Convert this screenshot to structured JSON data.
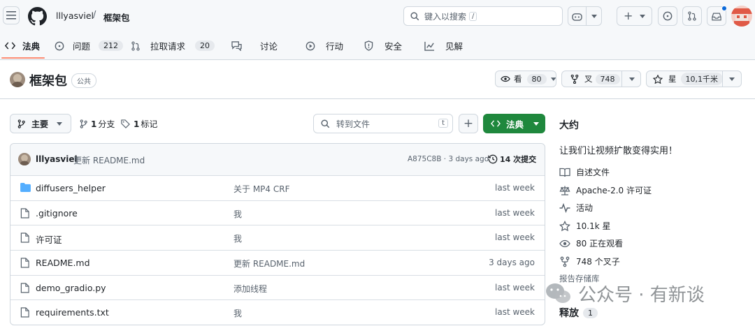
{
  "header": {
    "owner": "lllyasviel",
    "separator": "/",
    "repo": "框架包",
    "search_placeholder": "键入以搜索",
    "search_key": "/"
  },
  "tabs": [
    {
      "label": "法典",
      "icon": "code-icon"
    },
    {
      "label": "问题",
      "count": "212",
      "icon": "issue-icon"
    },
    {
      "label": "拉取请求",
      "count": "20",
      "icon": "pull-request-icon"
    },
    {
      "label": "讨论",
      "icon": "discussion-icon"
    },
    {
      "label": "行动",
      "icon": "play-icon"
    },
    {
      "label": "安全",
      "icon": "shield-icon"
    },
    {
      "label": "见解",
      "icon": "graph-icon"
    }
  ],
  "repo_header": {
    "name": "框架包",
    "visibility": "公共",
    "watch_label": "看",
    "watch_count": "80",
    "fork_label": "叉",
    "fork_count": "748",
    "star_label": "星",
    "star_count": "10,1千米"
  },
  "toolbar": {
    "branch": "主要",
    "branches_count": "1",
    "branches_label": "分支",
    "tags_count": "1",
    "tags_label": "标记",
    "goto_placeholder": "转到文件",
    "goto_key": "t",
    "add_label": "+",
    "code_label": "法典"
  },
  "commit": {
    "author": "lllyasviel",
    "message": "更新 README.md",
    "hash_time": "A875C8B · 3 days ago",
    "commits_label": "14 次提交"
  },
  "files": [
    {
      "name": "diffusers_helper",
      "type": "folder",
      "message": "关于 MP4 CRF",
      "date": "last week"
    },
    {
      "name": ".gitignore",
      "type": "file",
      "message": "我",
      "date": "last week"
    },
    {
      "name": "许可证",
      "type": "file",
      "message": "我",
      "date": "last week"
    },
    {
      "name": "README.md",
      "type": "file",
      "message": "更新 README.md",
      "date": "3 days ago"
    },
    {
      "name": "demo_gradio.py",
      "type": "file",
      "message": "添加线程",
      "date": "last week"
    },
    {
      "name": "requirements.txt",
      "type": "file",
      "message": "我",
      "date": "last week"
    }
  ],
  "about": {
    "title": "大约",
    "description": "让我们让视频扩散变得实用！",
    "readme": "自述文件",
    "license": "Apache-2.0 许可证",
    "activity": "活动",
    "stars": "10.1k 星",
    "watching": "80 正在观看",
    "forks": "748 个叉子",
    "report": "报告存储库",
    "releases_label": "释放",
    "releases_count": "1"
  },
  "watermark": "公众号 · 有新谈",
  "colors": {
    "accent_green": "#1f883d",
    "folder_blue": "#54aeff",
    "notification_blue": "#0969da",
    "active_tab_underline": "#fd8c73"
  }
}
